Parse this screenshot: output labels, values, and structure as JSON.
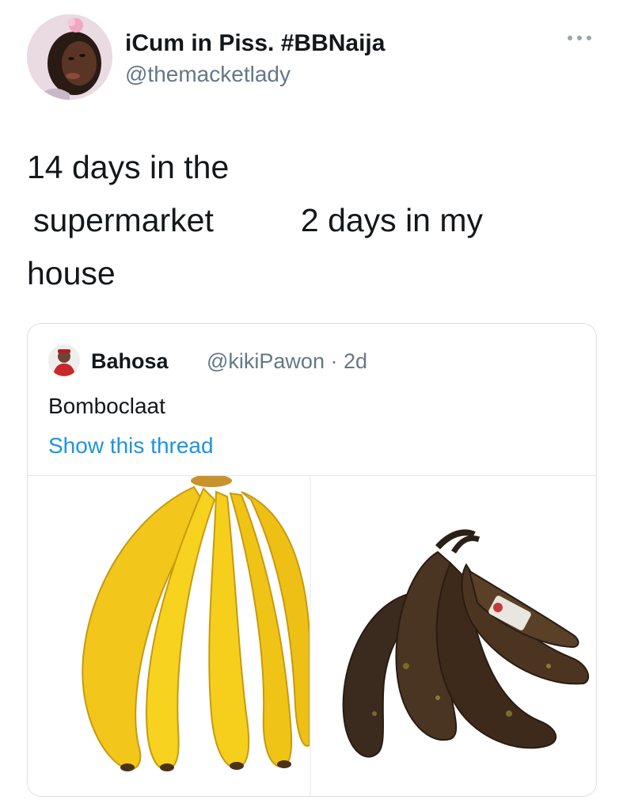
{
  "author": {
    "display_name": "iCum in Piss. #BBNaija",
    "handle": "@themacketlady",
    "avatar_icon": "profile-photo-icon",
    "more_icon": "more-options-icon"
  },
  "tweet": {
    "line1": "14 days in the",
    "line2_left": "supermarket",
    "line2_right": "2 days in my",
    "line3": "house"
  },
  "quoted": {
    "display_name": "Bahosa",
    "meta": "@kikiPawon · 2d",
    "text": "Bomboclaat",
    "show_thread": "Show this thread",
    "media": [
      "yellow-bananas-image",
      "rotten-bananas-image"
    ]
  },
  "colors": {
    "text": "#14171a",
    "secondary": "#657786",
    "link": "#1b95e0",
    "border": "#d9dfe3"
  }
}
